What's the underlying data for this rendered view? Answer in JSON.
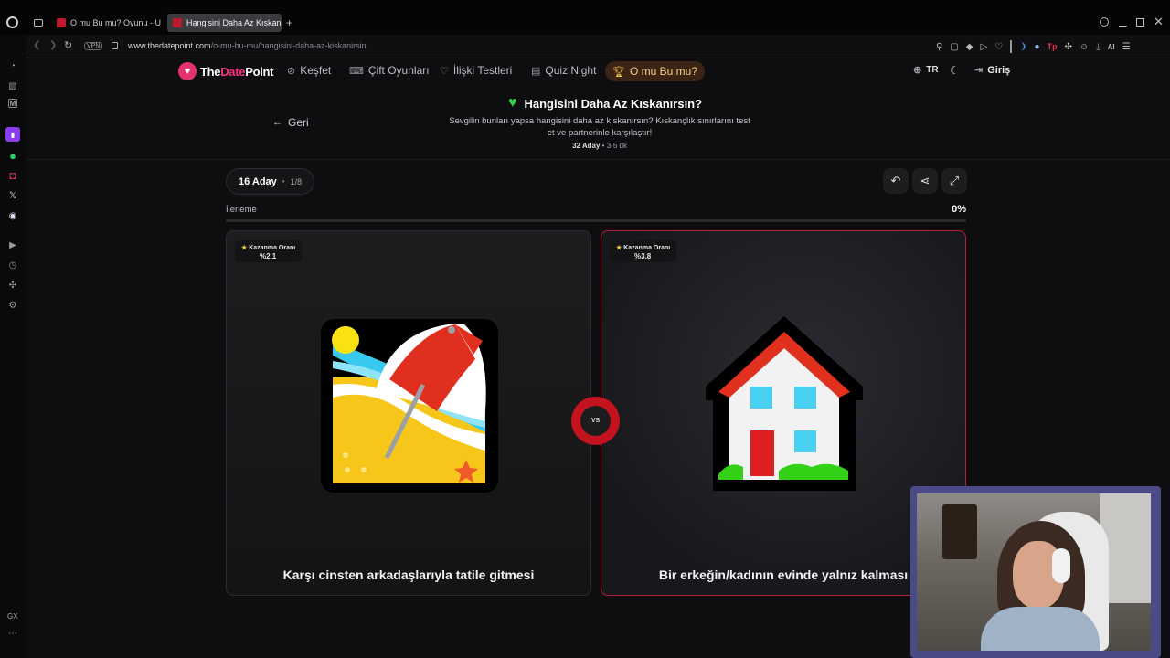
{
  "browser": {
    "tabs": [
      {
        "label": "O mu Bu mu? Oyunu - Uw"
      },
      {
        "label": "Hangisini Daha Az Kıskanır"
      }
    ],
    "url_host": "www.thedatepoint.com",
    "url_path": "/o-mu-bu-mu/hangisini-daha-az-kiskanirsin",
    "vpn": "VPN",
    "ai_label": "AI",
    "sidebar_bottom": "GX"
  },
  "site": {
    "logo_the": "The",
    "logo_date": "Date",
    "logo_point": "Point",
    "nav": {
      "kesfet": "Keşfet",
      "cift": "Çift Oyunları",
      "iliski": "İlişki Testleri",
      "quiz": "Quiz Night",
      "omu": "O mu Bu mu?"
    },
    "lang": "TR",
    "login": "Giriş"
  },
  "header": {
    "back": "Geri",
    "title": "Hangisini Daha Az Kıskanırsın?",
    "desc_line1": "Sevgilin bunları yapsa hangisini daha az kıskanırsın? Kıskançlık sınırlarını test",
    "desc_line2": "et ve partnerinle karşılaştır!",
    "candidates": "32 Aday",
    "duration": "3-5 dk"
  },
  "round": {
    "label": "16 Aday",
    "progress_text": "1/8"
  },
  "progress": {
    "label": "İlerleme",
    "percent_text": "0%",
    "value": 0
  },
  "cards": {
    "left": {
      "rate_label": "Kazanma Oranı",
      "rate": "%2.1",
      "caption": "Karşı cinsten arkadaşlarıyla tatile gitmesi"
    },
    "right": {
      "rate_label": "Kazanma Oranı",
      "rate": "%3.8",
      "caption": "Bir erkeğin/kadının evinde yalnız kalması"
    }
  },
  "vs": "VS",
  "colors": {
    "accent": "#e2336b",
    "brand_pink": "#ff2f7d",
    "gold": "#f5c24a",
    "active_border": "#b5203a"
  }
}
